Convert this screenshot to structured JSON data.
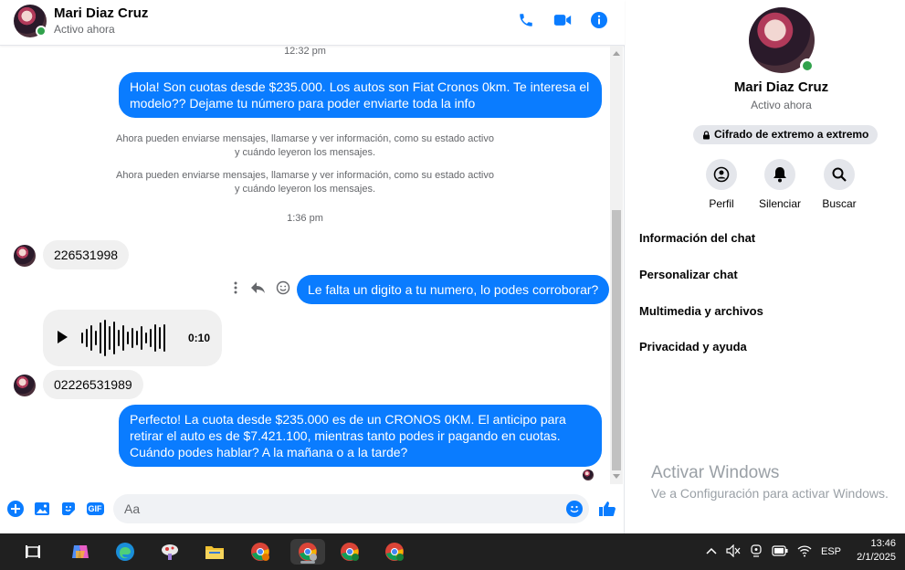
{
  "header": {
    "name": "Mari Diaz Cruz",
    "status": "Activo ahora"
  },
  "messages": {
    "time1": "12:32 pm",
    "msg1": "Hola! Son cuotas desde $235.000. Los autos son Fiat Cronos 0km. Te interesa el modelo?? Dejame tu número para poder enviarte toda la info",
    "system1_line1": "Ahora pueden enviarse mensajes, llamarse y ver información, como su estado activo",
    "system1_line2": "y cuándo leyeron los mensajes.",
    "system2_line1": "Ahora pueden enviarse mensajes, llamarse y ver información, como su estado activo",
    "system2_line2": "y cuándo leyeron los mensajes.",
    "time2": "1:36 pm",
    "msg2": "226531998",
    "msg3": "Le falta un digito a tu numero, lo podes corroborar?",
    "audio_duration": "0:10",
    "msg4": "02226531989",
    "msg5": "Perfecto! La cuota desde $235.000 es de un CRONOS 0KM. El anticipo para retirar el auto es de $7.421.100, mientras tanto podes ir pagando en cuotas. Cuándo podes hablar? A la mañana o a la tarde?"
  },
  "composer": {
    "placeholder": "Aa",
    "gif_label": "GIF"
  },
  "info": {
    "name": "Mari Diaz Cruz",
    "status": "Activo ahora",
    "e2e": "Cifrado de extremo a extremo",
    "actions": [
      {
        "label": "Perfil",
        "icon": "profile-icon"
      },
      {
        "label": "Silenciar",
        "icon": "bell-icon"
      },
      {
        "label": "Buscar",
        "icon": "search-icon"
      }
    ],
    "menu": [
      "Información del chat",
      "Personalizar chat",
      "Multimedia y archivos",
      "Privacidad y ayuda"
    ],
    "watermark_title": "Activar Windows",
    "watermark_sub": "Ve a Configuración para activar Windows."
  },
  "taskbar": {
    "lang": "ESP",
    "time": "13:46",
    "date": "2/1/2025"
  },
  "colors": {
    "accent": "#0a7cff",
    "online": "#31a24c",
    "taskbar": "#202020"
  }
}
